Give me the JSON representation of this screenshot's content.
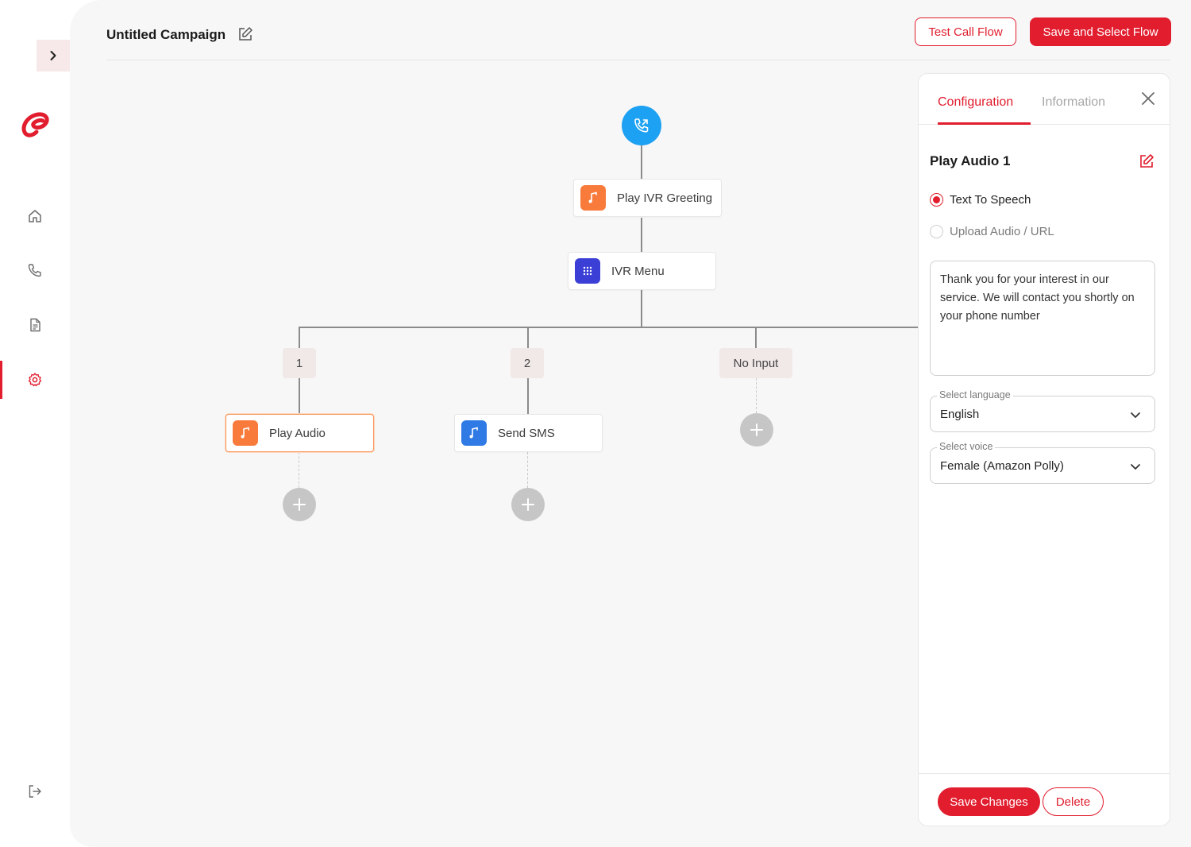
{
  "campaign": {
    "title": "Untitled Campaign"
  },
  "header": {
    "test_label": "Test Call Flow",
    "save_label": "Save and Select Flow"
  },
  "sidebar": {
    "items": [
      {
        "icon": "home-icon"
      },
      {
        "icon": "phone-icon"
      },
      {
        "icon": "document-icon"
      },
      {
        "icon": "settings-icon",
        "active": true
      }
    ]
  },
  "flow": {
    "greeting": {
      "label": "Play IVR Greeting",
      "icon": "music-note-icon",
      "color": "#f97b3c"
    },
    "menu": {
      "label": "IVR Menu",
      "icon": "keypad-icon",
      "color": "#3b3fd6"
    },
    "branches": [
      {
        "key": "1",
        "node": {
          "label": "Play Audio",
          "icon": "music-note-icon",
          "color": "#f97b3c",
          "selected": true
        }
      },
      {
        "key": "2",
        "node": {
          "label": "Send SMS",
          "icon": "music-note-icon",
          "color": "#2f7ae5"
        }
      },
      {
        "key": "No Input",
        "node": null
      }
    ]
  },
  "panel": {
    "tabs": [
      "Configuration",
      "Information"
    ],
    "active_tab": "Configuration",
    "title": "Play Audio 1",
    "options": [
      "Text To Speech",
      "Upload Audio / URL"
    ],
    "selected_option": "Text To Speech",
    "message": "Thank you for your interest in our service. We will contact you shortly on your phone number",
    "language": {
      "label": "Select language",
      "value": "English"
    },
    "voice": {
      "label": "Select voice",
      "value": "Female (Amazon Polly)"
    },
    "save_label": "Save Changes",
    "delete_label": "Delete"
  },
  "colors": {
    "accent": "#e11d2e",
    "start_node": "#1da1f2",
    "add_button": "#c6c6c6"
  }
}
